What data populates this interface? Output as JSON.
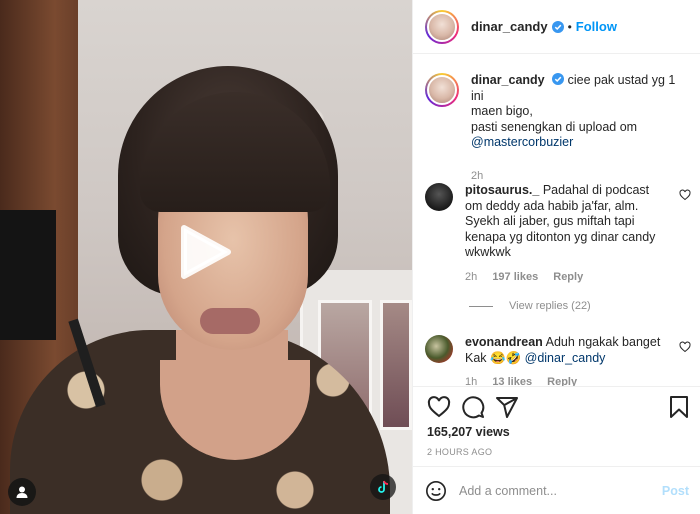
{
  "header": {
    "username": "dinar_candy",
    "separator": "•",
    "follow_label": "Follow"
  },
  "caption": {
    "username": "dinar_candy",
    "text_line1": "ciee pak ustad yg 1 ini",
    "text_line2": "maen bigo,",
    "text_line3": "pasti senengkan di upload om",
    "mention": "@mastercorbuzier",
    "time": "2h"
  },
  "comments": [
    {
      "username": "pitosaurus._",
      "text": "Padahal di podcast om deddy ada habib ja'far, alm. Syekh ali jaber, gus miftah tapi kenapa yg ditonton yg dinar candy wkwkwk",
      "time": "2h",
      "likes": "197 likes",
      "reply": "Reply",
      "view_replies": "View replies (22)"
    },
    {
      "username": "evonandrean",
      "text": "Aduh ngakak banget Kak 😂🤣",
      "mention": "@dinar_candy",
      "time": "1h",
      "likes": "13 likes",
      "reply": "Reply"
    }
  ],
  "stats": {
    "views": "165,207 views",
    "time_ago": "2 HOURS AGO"
  },
  "add_comment": {
    "placeholder": "Add a comment...",
    "post_label": "Post"
  },
  "colors": {
    "accent": "#0095f6",
    "mention": "#00376b",
    "muted": "#8e8e8e",
    "post_disabled": "#b2dffc"
  },
  "icons": {
    "verified": "verified-badge-icon",
    "heart": "heart-icon",
    "comment": "comment-icon",
    "share": "share-icon",
    "save": "bookmark-icon",
    "emoji": "emoji-icon",
    "play": "play-icon",
    "user_tag": "user-tag-icon",
    "tiktok": "tiktok-icon"
  }
}
